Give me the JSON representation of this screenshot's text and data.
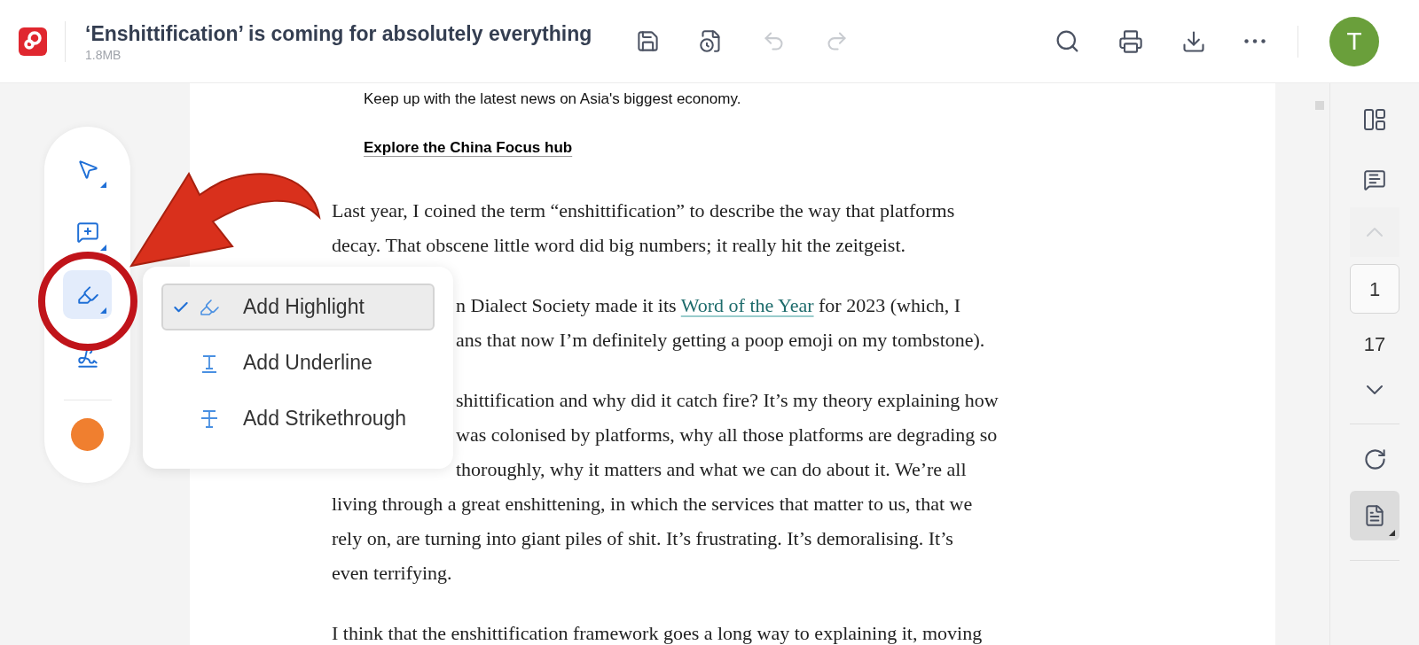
{
  "header": {
    "title": "‘Enshittification’ is coming for absolutely everything",
    "size": "1.8MB",
    "avatar": "T",
    "undo": {
      "disabled": true
    },
    "redo": {
      "disabled": true
    }
  },
  "tools": [
    {
      "kind": "select",
      "selected": false,
      "has_menu": true
    },
    {
      "kind": "comment",
      "selected": false,
      "has_menu": true
    },
    {
      "kind": "highlight",
      "selected": true,
      "has_menu": true
    },
    {
      "kind": "draw",
      "selected": false,
      "has_menu": false
    }
  ],
  "menu": [
    {
      "kind": "highlight",
      "label": "Add Highlight",
      "selected": true
    },
    {
      "kind": "underline",
      "label": "Add Underline",
      "selected": false
    },
    {
      "kind": "strikethrough",
      "label": "Add Strikethrough",
      "selected": false
    }
  ],
  "document": {
    "intro": "Keep up with the latest news on Asia's biggest economy.",
    "hub_link": "Explore the China Focus hub",
    "paragraphs": [
      {
        "lines": [
          {
            "covered": false,
            "parts": [
              {
                "text": "Last year, I coined the term “enshittification” to describe the way that platforms",
                "link": false
              }
            ]
          },
          {
            "covered": false,
            "parts": [
              {
                "text": "decay. That obscene little word did big numbers; it really hit the zeitgeist.",
                "link": false
              }
            ]
          }
        ]
      },
      {
        "lines": [
          {
            "covered": true,
            "parts": [
              {
                "text": "n Dialect Society made it its ",
                "link": false
              },
              {
                "text": "Word of the Year",
                "link": true
              },
              {
                "text": " for 2023 (which, I",
                "link": false
              }
            ]
          },
          {
            "covered": true,
            "parts": [
              {
                "text": "ans that now I’m definitely getting a poop emoji on my tombstone).",
                "link": false
              }
            ]
          }
        ]
      },
      {
        "lines": [
          {
            "covered": true,
            "parts": [
              {
                "text": "shittification and why did it catch fire? It’s my theory explaining how",
                "link": false
              }
            ]
          },
          {
            "covered": true,
            "parts": [
              {
                "text": "was colonised by platforms, why all those platforms are degrading so",
                "link": false
              }
            ]
          },
          {
            "covered": true,
            "parts": [
              {
                "text": "thoroughly, why it matters and what we can do about it. We’re all",
                "link": false
              }
            ]
          },
          {
            "covered": false,
            "parts": [
              {
                "text": "living through a great enshittening, in which the services that matter to us, that we",
                "link": false
              }
            ]
          },
          {
            "covered": false,
            "parts": [
              {
                "text": "rely on, are turning into giant piles of shit. It’s frustrating. It’s demoralising. It’s",
                "link": false
              }
            ]
          },
          {
            "covered": false,
            "parts": [
              {
                "text": "even terrifying.",
                "link": false
              }
            ]
          }
        ]
      },
      {
        "lines": [
          {
            "covered": false,
            "parts": [
              {
                "text": "I think that the enshittification framework goes a long way to explaining it, moving",
                "link": false
              }
            ]
          }
        ]
      }
    ]
  },
  "pager": {
    "page": "1",
    "total": "17",
    "prev": {
      "disabled": true
    }
  }
}
